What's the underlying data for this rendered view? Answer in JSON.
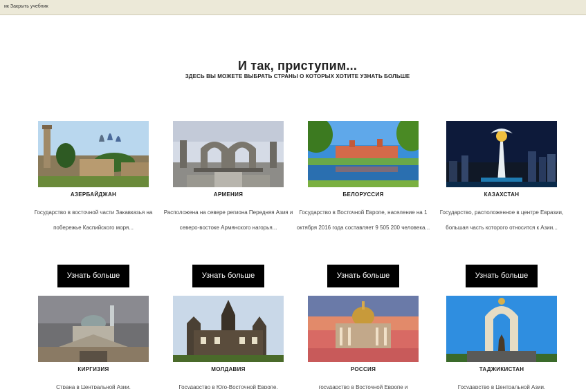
{
  "window": {
    "toolbar_text": "ик  Закрыть учебник"
  },
  "header": {
    "title": "И так, приступим...",
    "subtitle": "ЗДЕСЬ ВЫ МОЖЕТЕ ВЫБРАТЬ СТРАНЫ О КОТОРЫХ ХОТИТЕ УЗНАТЬ БОЛЬШЕ"
  },
  "countries": [
    {
      "name": "АЗЕРБАЙДЖАН",
      "description": "Государство в восточной части Закавказья на побережье Каспийского моря...",
      "button": "Узнать больше"
    },
    {
      "name": "АРМЕНИЯ",
      "description": "Расположена на севере региона Передняя Азия и северо-востоке Армянского нагорья...",
      "button": "Узнать больше"
    },
    {
      "name": "БЕЛОРУССИЯ",
      "description": "Государство в Восточной Европе, население на 1 октября 2016 года составляет 9 505 200 человека...",
      "button": "Узнать больше"
    },
    {
      "name": "КАЗАХСТАН",
      "description": "Государство, расположенное в центре Евразии, большая часть которого относится к Азии...",
      "button": "Узнать больше"
    },
    {
      "name": "КИРГИЗИЯ",
      "description": "Страна в Центральной Азии,"
    },
    {
      "name": "МОЛДАВИЯ",
      "description": "Государство в Юго-Восточной Европе."
    },
    {
      "name": "РОССИЯ",
      "description": "государство в Восточной Европе и"
    },
    {
      "name": "ТАДЖИКИСТАН",
      "description": "Государство в Центральной Азии,"
    }
  ]
}
